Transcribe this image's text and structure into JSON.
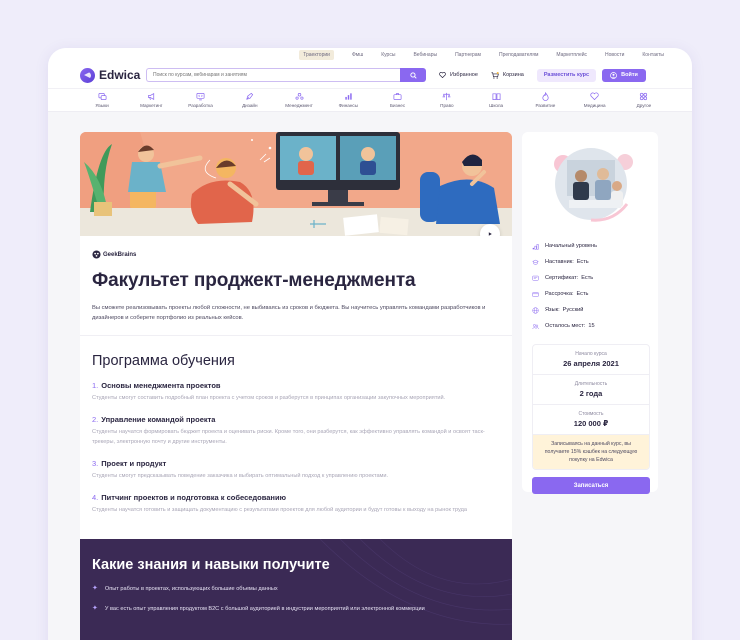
{
  "topnav": [
    "Траектории",
    "Фмш",
    "Курсы",
    "Вебинары",
    "Партнерам",
    "Преподавателям",
    "Маркетплейс",
    "Новости",
    "Контакты"
  ],
  "brand": {
    "name": "Edwica",
    "accent": "#8a68f0"
  },
  "search": {
    "placeholder": "Поиск по курсам, вебинарам и занятиям"
  },
  "header": {
    "favorites": "Избранное",
    "cart": "Корзина",
    "post_course": "Разместить курс",
    "login": "Войти"
  },
  "categories": [
    "Языки",
    "Маркетинг",
    "Разработка",
    "Дизайн",
    "Менеджмент",
    "Финансы",
    "Бизнес",
    "Право",
    "Школа",
    "Развитие",
    "Медицина",
    "Другое"
  ],
  "course": {
    "provider": "GeekBrains",
    "title": "Факультет проджект-менеджмента",
    "description": "Вы сможете реализовывать проекты любой сложности, не выбиваясь из сроков и бюджета. Вы научитесь управлять командами разработчиков и дизайнеров и соберете портфолио из реальных кейсов."
  },
  "program": {
    "title": "Программа обучения",
    "modules": [
      {
        "num": "1.",
        "title": "Основы менеджмента проектов",
        "desc": "Студенты смогут составить подробный план проекта с учетом сроков и разберутся в принципах организации закупочных мероприятий."
      },
      {
        "num": "2.",
        "title": "Управление командой проекта",
        "desc": "Студенты научатся формировать бюджет проекта и оценивать риски. Кроме того, они разберутся, как эффективно управлять командой и освоят таск-трекеры, электронную почту и другие инструменты."
      },
      {
        "num": "3.",
        "title": "Проект и продукт",
        "desc": "Студенты смогут предсказывать поведение заказчика и выбирать оптимальный подход к управлению проектами."
      },
      {
        "num": "4.",
        "title": "Питчинг проектов и подготовка к собеседованию",
        "desc": "Студенты научатся готовить и защищать документацию с результатами проектов для любой аудитории и будут готовы к выходу на рынок труда"
      }
    ]
  },
  "skills": {
    "title": "Какие знания и навыки получите",
    "items": [
      "Опыт работы в проектах, использующих большие объемы данных",
      "У вас есть опыт управления продуктом B2C с большой аудиторией в индустрии мероприятий или электронной коммерции"
    ]
  },
  "sidebar": {
    "facts": [
      {
        "icon": "level-icon",
        "label": "Начальный уровень",
        "value": ""
      },
      {
        "icon": "mentor-icon",
        "label": "Наставник:",
        "value": "Есть"
      },
      {
        "icon": "certificate-icon",
        "label": "Сертификат:",
        "value": "Есть"
      },
      {
        "icon": "installment-icon",
        "label": "Рассрочка:",
        "value": "Есть"
      },
      {
        "icon": "globe-icon",
        "label": "Язык:",
        "value": "Русский"
      },
      {
        "icon": "seats-icon",
        "label": "Осталось мест:",
        "value": "15"
      }
    ],
    "start_label": "Начало курса",
    "start_value": "26 апреля 2021",
    "duration_label": "Длительность",
    "duration_value": "2 года",
    "price_label": "Стоимость",
    "price_value": "120 000 ₽",
    "cashback": "Записываясь на данный курс, вы получаете 15% кэшбек на следующую покупку на Edwica",
    "enroll": "Записаться"
  }
}
